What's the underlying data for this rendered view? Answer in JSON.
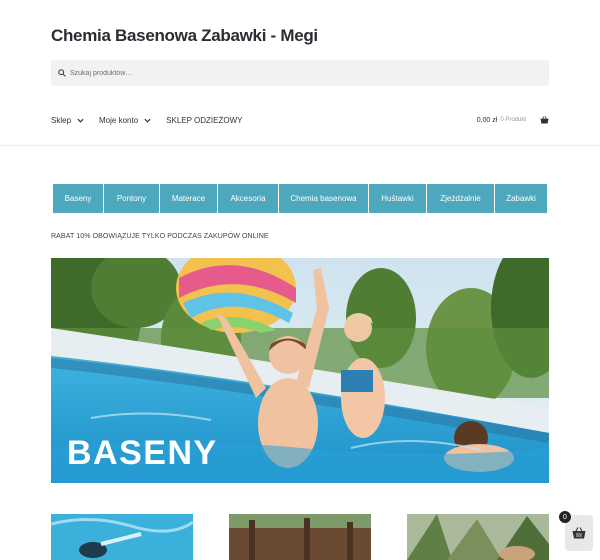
{
  "site": {
    "title": "Chemia Basenowa Zabawki - Megi"
  },
  "search": {
    "placeholder": "Szukaj produktów…"
  },
  "nav": {
    "items": [
      {
        "label": "Sklep",
        "has_dropdown": true
      },
      {
        "label": "Moje konto",
        "has_dropdown": true
      },
      {
        "label": "SKLEP ODZIEŻOWY",
        "has_dropdown": false
      }
    ]
  },
  "cart": {
    "amount": "0,00 zł",
    "count_label": "0 Produkt",
    "icon": "basket-icon"
  },
  "categories": [
    "Baseny",
    "Pontony",
    "Materace",
    "Akcesoria",
    "Chemia basenowa",
    "Huśtawki",
    "Zjeżdżalnie",
    "Zabawki"
  ],
  "promo": {
    "text": "RABAT 10% OBOWIĄZUJE TYLKO PODCZAS ZAKUPÓW ONLINE"
  },
  "hero": {
    "caption": "BASENY"
  },
  "floating_cart": {
    "count": "0",
    "icon": "basket-icon"
  },
  "colors": {
    "category_bar": "#4da8bd",
    "title": "#2c2d33",
    "search_bg": "#f2f2f2"
  }
}
